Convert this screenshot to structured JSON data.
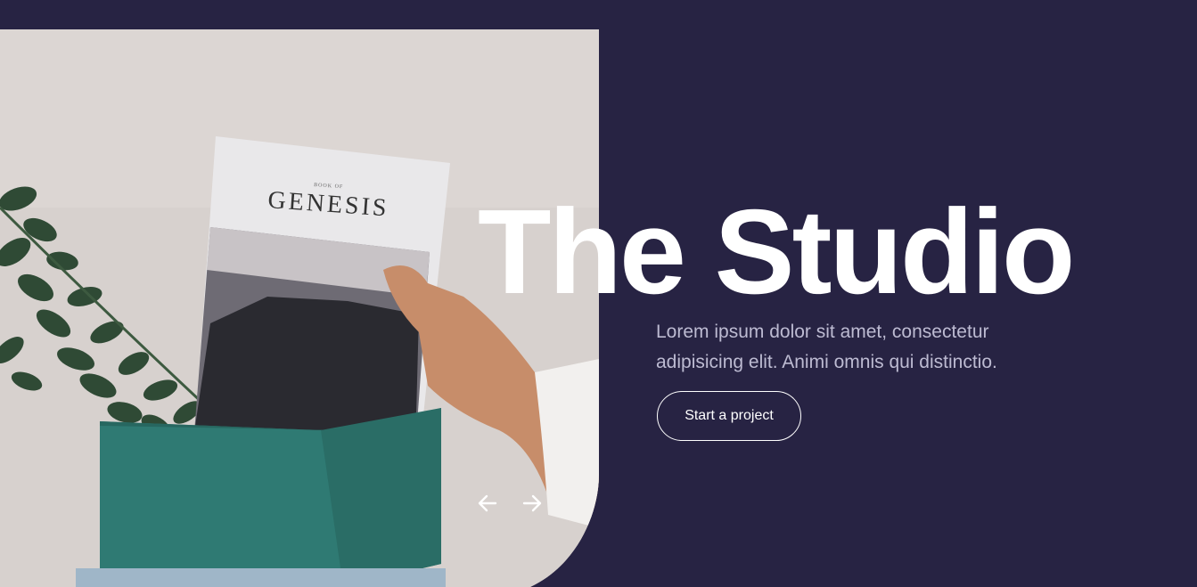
{
  "hero": {
    "image_alt": "Hand holding a Genesis book over a teal box with eucalyptus",
    "book_cover_small": "BOOK OF",
    "book_cover_title": "GENESIS",
    "title": "The Studio",
    "subtitle": "Lorem ipsum dolor sit amet, consectetur adipisicing elit. Animi omnis qui distinctio.",
    "cta_label": "Start a project"
  },
  "slider": {
    "prev_icon": "arrow-left-icon",
    "next_icon": "arrow-right-icon"
  },
  "colors": {
    "background": "#272343",
    "text": "#ffffff",
    "muted_text": "#bdbbd2",
    "box_teal": "#2f7a73"
  }
}
